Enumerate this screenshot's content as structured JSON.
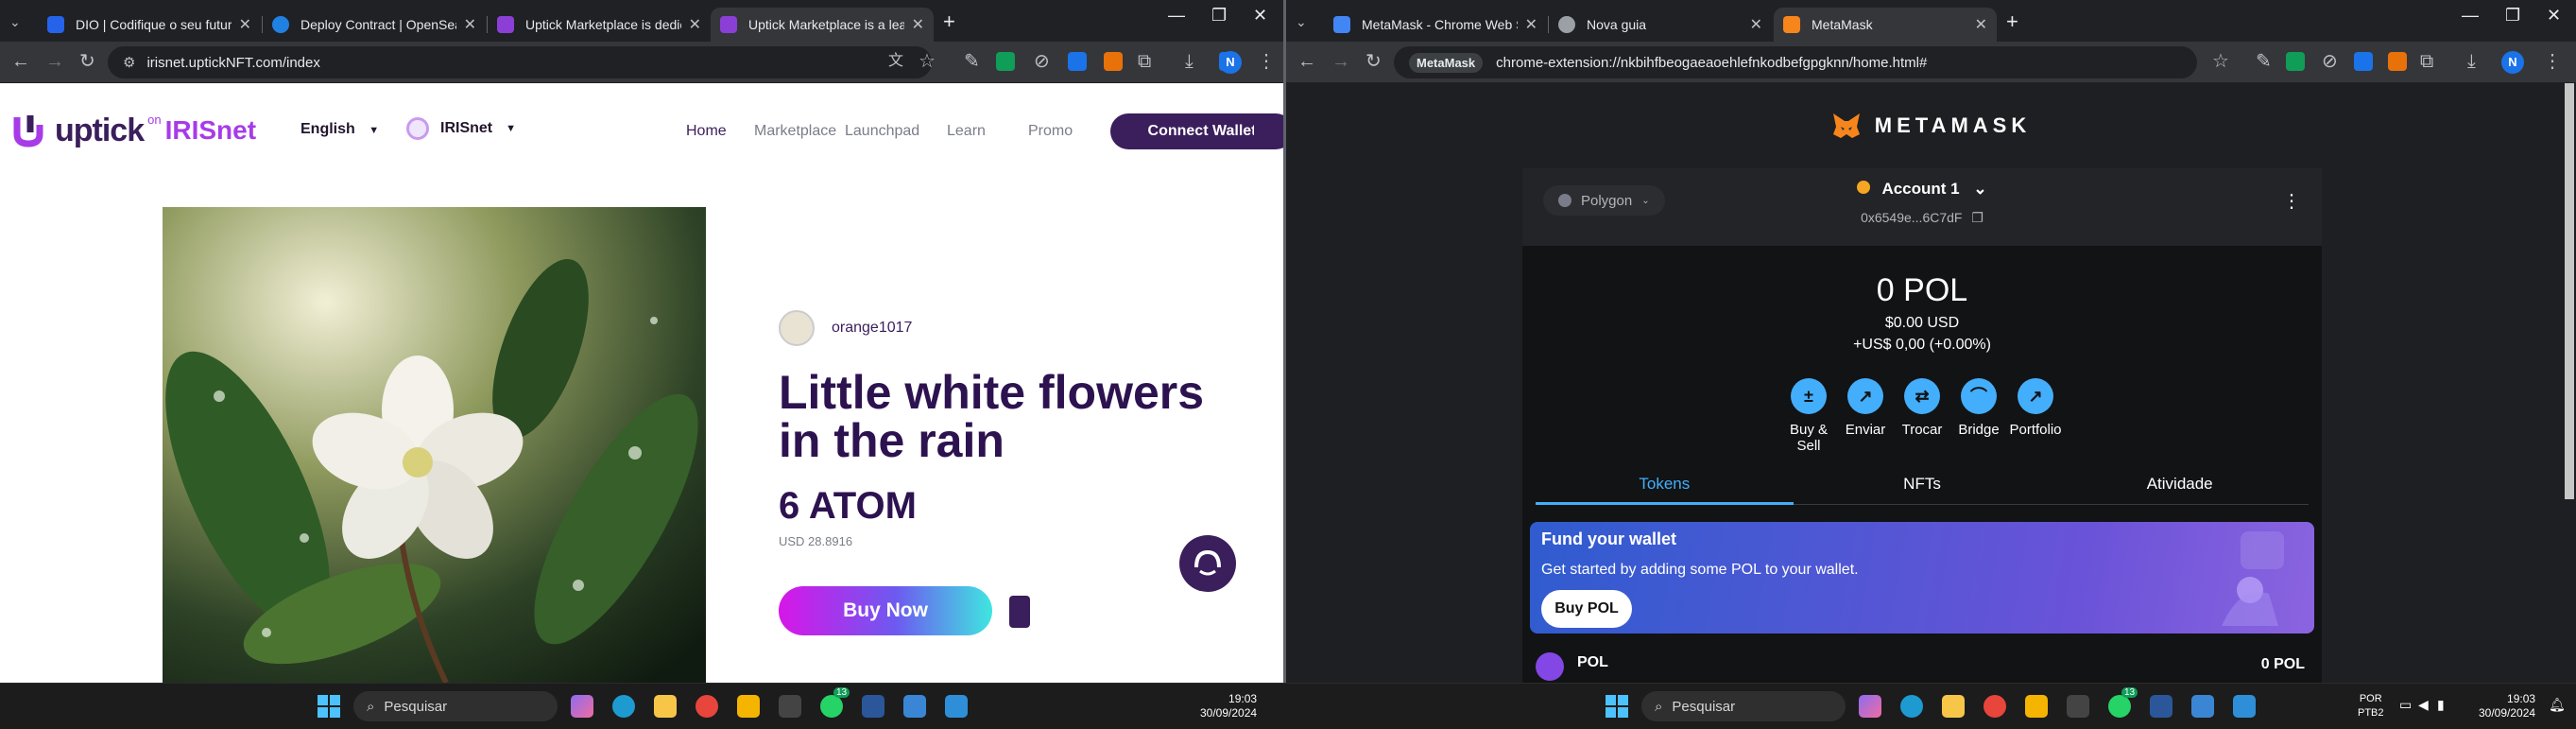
{
  "left_browser": {
    "tabs": [
      {
        "title": "DIO | Codifique o seu futuro gl",
        "favicon_color": "#2563eb"
      },
      {
        "title": "Deploy Contract | OpenSea",
        "favicon_color": "#2081e2"
      },
      {
        "title": "Uptick Marketplace is dedicate",
        "favicon_color": "#8b3fd6"
      },
      {
        "title": "Uptick Marketplace is a leading",
        "favicon_color": "#8b3fd6"
      }
    ],
    "url": "irisnet.uptickNFT.com/index",
    "page": {
      "logo_text": "uptick",
      "logo_on": "on",
      "logo_network": "IRISnet",
      "language": "English",
      "network": "IRISnet",
      "nav": [
        "Home",
        "Marketplace",
        "Launchpad",
        "Learn",
        "Promo"
      ],
      "connect_wallet": "Connect Wallet",
      "creator": "orange1017",
      "title": "Little white flowers in the rain",
      "price": "6 ATOM",
      "usd_price": "USD 28.8916",
      "buy_now": "Buy Now"
    }
  },
  "right_browser": {
    "tabs": [
      {
        "title": "MetaMask - Chrome Web Store",
        "favicon_color": "#4285f4"
      },
      {
        "title": "Nova guia",
        "favicon_color": "#9aa0a6"
      },
      {
        "title": "MetaMask",
        "favicon_color": "#f6851b"
      }
    ],
    "url_badge": "MetaMask",
    "url": "chrome-extension://nkbihfbeogaeaoehlefnkodbefgpgknn/home.html#",
    "metamask": {
      "brand": "METAMASK",
      "network": "Polygon",
      "account": "Account 1",
      "address": "0x6549e...6C7dF",
      "balance": "0 POL",
      "balance_usd": "$0.00 USD",
      "change": "+US$ 0,00 (+0.00%)",
      "actions": [
        "Buy & Sell",
        "Enviar",
        "Trocar",
        "Bridge",
        "Portfolio"
      ],
      "tabs": [
        "Tokens",
        "NFTs",
        "Atividade"
      ],
      "fund_title": "Fund your wallet",
      "fund_text": "Get started by adding some POL to your wallet.",
      "fund_button": "Buy POL",
      "token_name": "POL",
      "token_amount": "0 POL"
    }
  },
  "taskbar_left": {
    "search": "Pesquisar",
    "time": "19:03",
    "date": "30/09/2024",
    "whatsapp_badge": "13"
  },
  "taskbar_right": {
    "search": "Pesquisar",
    "lang1": "POR",
    "lang2": "PTB2",
    "time": "19:03",
    "date": "30/09/2024",
    "whatsapp_badge": "13"
  }
}
